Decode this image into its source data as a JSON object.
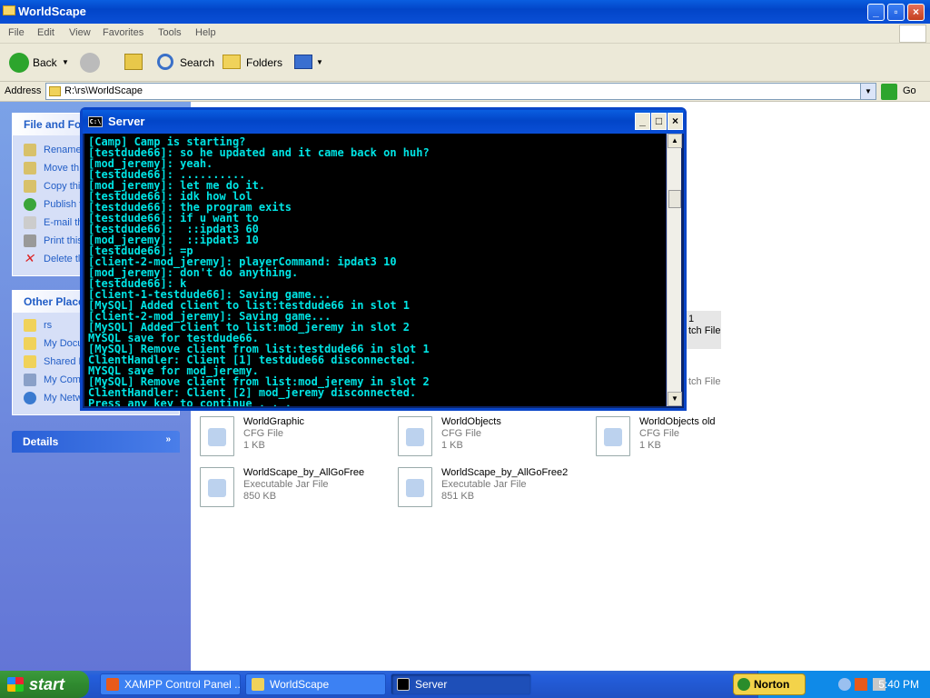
{
  "explorer": {
    "title": "WorldScape",
    "menu": [
      "File",
      "Edit",
      "View",
      "Favorites",
      "Tools",
      "Help"
    ],
    "toolbar": {
      "back": "Back",
      "search": "Search",
      "folders": "Folders"
    },
    "address": {
      "label": "Address",
      "value": "R:\\rs\\WorldScape",
      "go": "Go"
    },
    "file_tasks": {
      "header": "File and Fol",
      "items": [
        "Rename",
        "Move th",
        "Copy thi",
        "Publish t",
        "E-mail th",
        "Print this",
        "Delete tl"
      ]
    },
    "other_places": {
      "header": "Other Place",
      "items": [
        "rs",
        "My Docu",
        "Shared D",
        "My Comp",
        "My Netw"
      ]
    },
    "details": {
      "header": "Details"
    },
    "partial_labels": [
      "1",
      "tch File",
      "tch File"
    ],
    "files": [
      {
        "name": "WorldGraphic",
        "type": "CFG File",
        "size": "1 KB"
      },
      {
        "name": "WorldObjects",
        "type": "CFG File",
        "size": "1 KB"
      },
      {
        "name": "WorldObjects old",
        "type": "CFG File",
        "size": "1 KB"
      },
      {
        "name": "WorldScape_by_AllGoFree",
        "type": "Executable Jar File",
        "size": "850 KB"
      },
      {
        "name": "WorldScape_by_AllGoFree2",
        "type": "Executable Jar File",
        "size": "851 KB"
      }
    ]
  },
  "console": {
    "title": "Server",
    "icon_text": "C:\\",
    "lines": [
      "[Camp] Camp is starting?",
      "[testdude66]: so he updated and it came back on huh?",
      "[mod_jeremy]: yeah.",
      "[testdude66]: ..........",
      "[mod_jeremy]: let me do it.",
      "[testdude66]: idk how lol",
      "[testdude66]: the program exits",
      "[testdude66]: if u want to",
      "[testdude66]:  ::ipdat3 60",
      "[mod_jeremy]:  ::ipdat3 10",
      "[testdude66]: =p",
      "[client-2-mod_jeremy]: playerCommand: ipdat3 10",
      "[mod_jeremy]: don't do anything.",
      "[testdude66]: k",
      "[client-1-testdude66]: Saving game...",
      "[MySQL] Added client to list:testdude66 in slot 1",
      "[client-2-mod_jeremy]: Saving game...",
      "[MySQL] Added client to list:mod_jeremy in slot 2",
      "MYSQL save for testdude66.",
      "[MySQL] Remove client from list:testdude66 in slot 1",
      "ClientHandler: Client [1] testdude66 disconnected.",
      "MYSQL save for mod_jeremy.",
      "[MySQL] Remove client from list:mod_jeremy in slot 2",
      "ClientHandler: Client [2] mod_jeremy disconnected.",
      "Press any key to continue . . ."
    ]
  },
  "taskbar": {
    "start": "start",
    "tasks": [
      "XAMPP Control Panel ...",
      "WorldScape",
      "Server"
    ],
    "norton": "Norton",
    "clock": "5:40 PM"
  },
  "colors": {
    "console_text": "#00e4e4",
    "xp_blue": "#0a5ee0",
    "taskbar": "#245edc",
    "start_green": "#2f8a2f"
  }
}
